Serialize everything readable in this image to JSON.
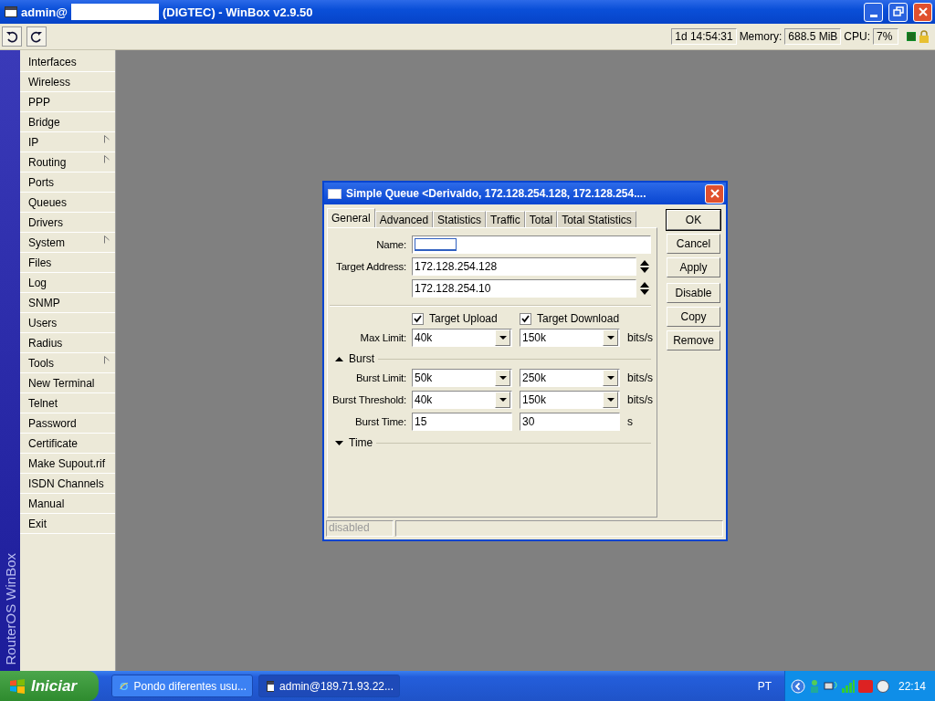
{
  "window": {
    "title_prefix": "admin@",
    "title_suffix": "(DIGTEC) - WinBox v2.9.50"
  },
  "toolbar": {
    "uptime": "1d 14:54:31",
    "memory_label": "Memory:",
    "memory": "688.5 MiB",
    "cpu_label": "CPU:",
    "cpu": "7%"
  },
  "sidebar": {
    "brand": "RouterOS WinBox",
    "items": [
      {
        "label": "Interfaces",
        "submenu": false
      },
      {
        "label": "Wireless",
        "submenu": false
      },
      {
        "label": "PPP",
        "submenu": false
      },
      {
        "label": "Bridge",
        "submenu": false
      },
      {
        "label": "IP",
        "submenu": true
      },
      {
        "label": "Routing",
        "submenu": true
      },
      {
        "label": "Ports",
        "submenu": false
      },
      {
        "label": "Queues",
        "submenu": false
      },
      {
        "label": "Drivers",
        "submenu": false
      },
      {
        "label": "System",
        "submenu": true
      },
      {
        "label": "Files",
        "submenu": false
      },
      {
        "label": "Log",
        "submenu": false
      },
      {
        "label": "SNMP",
        "submenu": false
      },
      {
        "label": "Users",
        "submenu": false
      },
      {
        "label": "Radius",
        "submenu": false
      },
      {
        "label": "Tools",
        "submenu": true
      },
      {
        "label": "New Terminal",
        "submenu": false
      },
      {
        "label": "Telnet",
        "submenu": false
      },
      {
        "label": "Password",
        "submenu": false
      },
      {
        "label": "Certificate",
        "submenu": false
      },
      {
        "label": "Make Supout.rif",
        "submenu": false
      },
      {
        "label": "ISDN Channels",
        "submenu": false
      },
      {
        "label": "Manual",
        "submenu": false
      },
      {
        "label": "Exit",
        "submenu": false
      }
    ]
  },
  "dialog": {
    "title": "Simple Queue <Derivaldo, 172.128.254.128, 172.128.254....",
    "tabs": [
      {
        "label": "General",
        "selected": true
      },
      {
        "label": "Advanced",
        "selected": false
      },
      {
        "label": "Statistics",
        "selected": false
      },
      {
        "label": "Traffic",
        "selected": false
      },
      {
        "label": "Total",
        "selected": false
      },
      {
        "label": "Total Statistics",
        "selected": false
      }
    ],
    "name": {
      "label": "Name:"
    },
    "target_address": {
      "label": "Target Address:",
      "values": [
        "172.128.254.128",
        "172.128.254.10"
      ]
    },
    "checks": [
      {
        "label": "Target Upload",
        "checked": true
      },
      {
        "label": "Target Download",
        "checked": true
      }
    ],
    "max_limit": {
      "label": "Max Limit:",
      "kind": "combo",
      "values": [
        "40k",
        "150k"
      ],
      "unit": "bits/s"
    },
    "sections": [
      {
        "label": "Burst",
        "expanded": true,
        "rows": [
          {
            "label": "Burst Limit:",
            "kind": "combo",
            "values": [
              "50k",
              "250k"
            ],
            "unit": "bits/s"
          },
          {
            "label": "Burst Threshold:",
            "kind": "combo",
            "values": [
              "40k",
              "150k"
            ],
            "unit": "bits/s"
          },
          {
            "label": "Burst Time:",
            "kind": "text",
            "values": [
              "15",
              "30"
            ],
            "unit": "s"
          }
        ]
      },
      {
        "label": "Time",
        "expanded": false
      }
    ],
    "button_groups": [
      [
        {
          "label": "OK",
          "default": true
        },
        {
          "label": "Cancel",
          "default": false
        },
        {
          "label": "Apply",
          "default": false
        }
      ],
      [
        {
          "label": "Disable",
          "default": false
        },
        {
          "label": "Copy",
          "default": false
        },
        {
          "label": "Remove",
          "default": false
        }
      ]
    ],
    "status": {
      "text": "disabled",
      "disabled": true
    }
  },
  "taskbar": {
    "start": "Iniciar",
    "tasks": [
      {
        "label": "Pondo diferentes usu...",
        "selected": false
      },
      {
        "label": "admin@189.71.93.22...",
        "selected": true
      }
    ],
    "language": "PT",
    "clock": "22:14"
  }
}
